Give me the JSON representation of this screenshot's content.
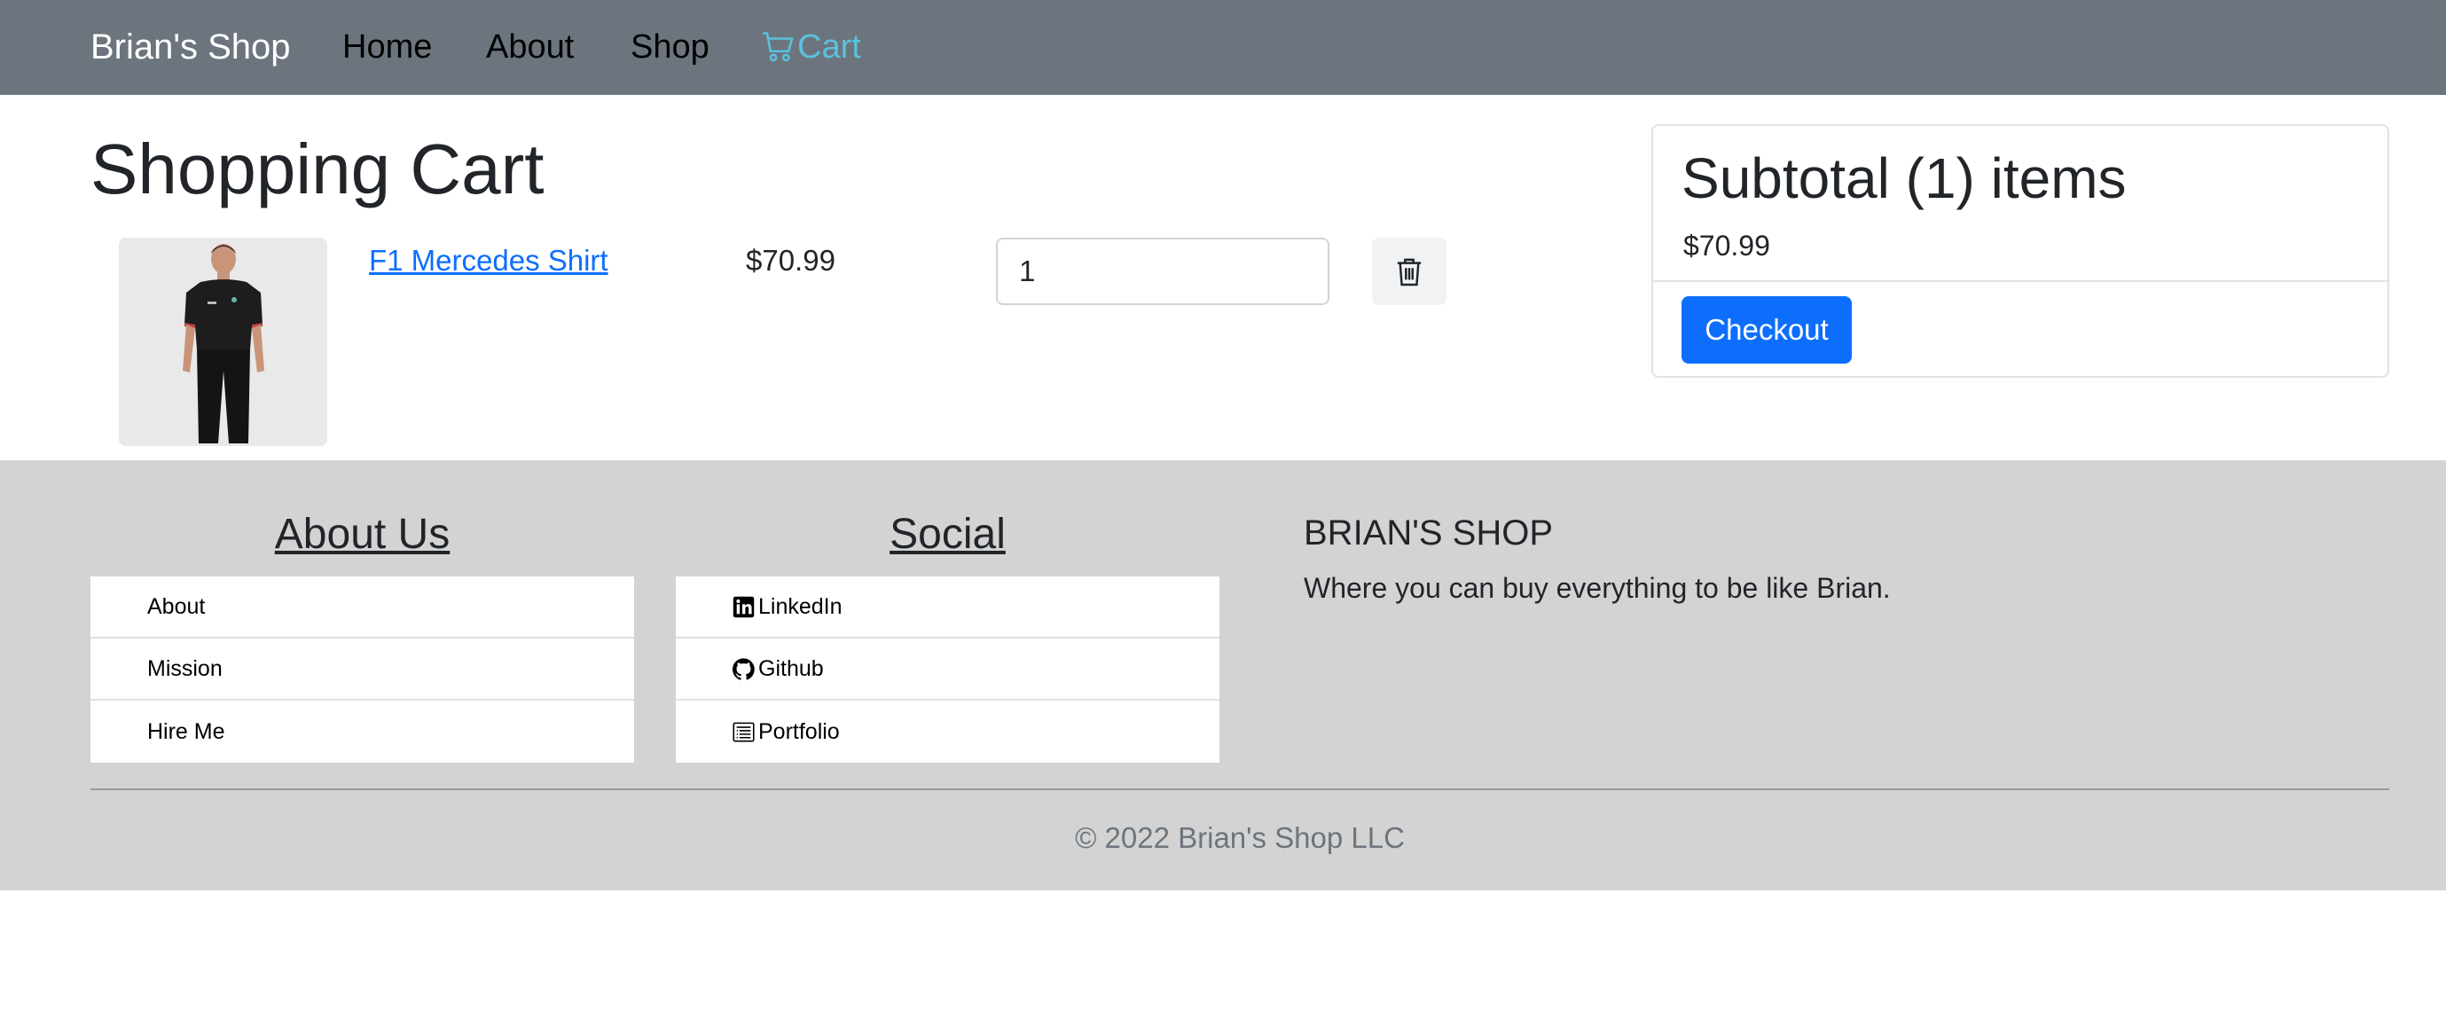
{
  "navbar": {
    "brand": "Brian's Shop",
    "links": [
      "Home",
      "About",
      "Shop"
    ],
    "cart_label": "Cart",
    "cart_color": "#5bc0de",
    "background": "#6c757d"
  },
  "main": {
    "title": "Shopping Cart",
    "cart_items": [
      {
        "name": "F1 Mercedes Shirt",
        "price": "$70.99",
        "quantity": "1",
        "image_icon": "shirt-product-photo",
        "delete_icon": "trash-icon"
      }
    ]
  },
  "subtotal": {
    "title": "Subtotal (1) items",
    "price": "$70.99",
    "checkout_label": "Checkout",
    "accent": "#0d6efd"
  },
  "footer": {
    "about_heading": "About Us",
    "about_items": [
      "About",
      "Mission",
      "Hire Me"
    ],
    "social_heading": "Social",
    "social_items": [
      {
        "label": "LinkedIn",
        "icon": "linkedin-icon"
      },
      {
        "label": "Github",
        "icon": "github-icon"
      },
      {
        "label": "Portfolio",
        "icon": "portfolio-icon"
      }
    ],
    "shop_title": "BRIAN'S SHOP",
    "shop_desc": "Where you can buy everything to be like Brian.",
    "copyright": "© 2022 Brian's Shop LLC",
    "background": "#d3d3d3"
  }
}
